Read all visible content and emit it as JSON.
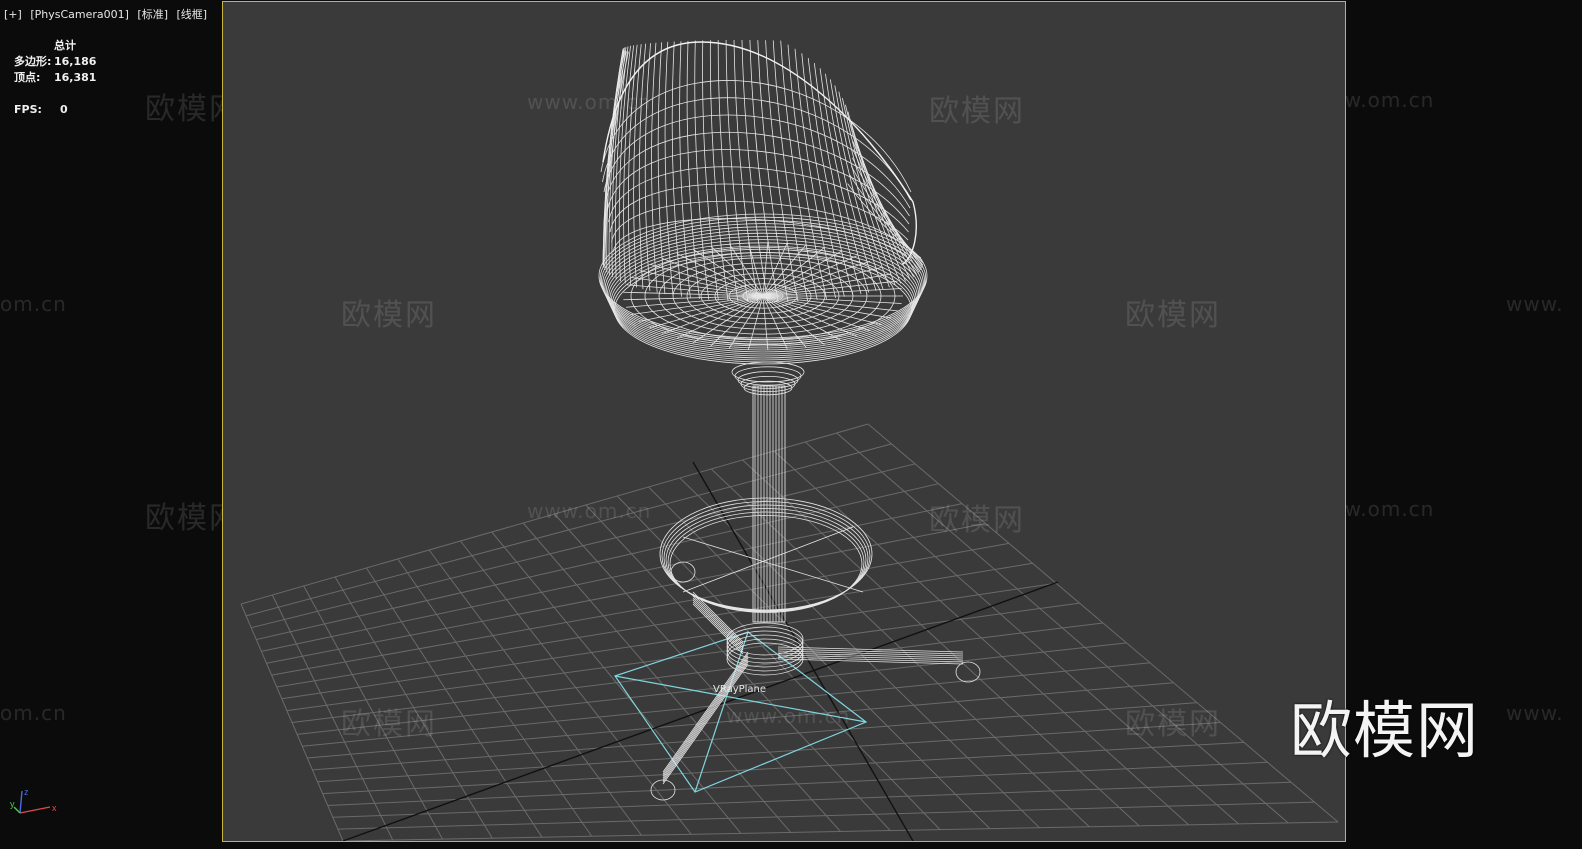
{
  "viewport": {
    "label_items": [
      "[+]",
      "[PhysCamera001]",
      "[标准]",
      "[线框]"
    ],
    "active_border_color": "#c9b53d",
    "background_color": "#3a3a3a"
  },
  "stats": {
    "header": "总计",
    "polygons_label": "多边形:",
    "polygons_value": "16,186",
    "vertices_label": "顶点:",
    "vertices_value": "16,381",
    "fps_label": "FPS:",
    "fps_value": "0"
  },
  "scene": {
    "object_label": "VRayPlane",
    "wireframe_color": "#e6e6e6",
    "selection_color": "#7fd6e0"
  },
  "watermark": {
    "cn": "欧模网",
    "url": "www.om.cn",
    "url_left": "om.cn",
    "url_right": "www.",
    "brand": "欧模网"
  },
  "axis": {
    "x": "x",
    "y": "y",
    "z": "z"
  }
}
